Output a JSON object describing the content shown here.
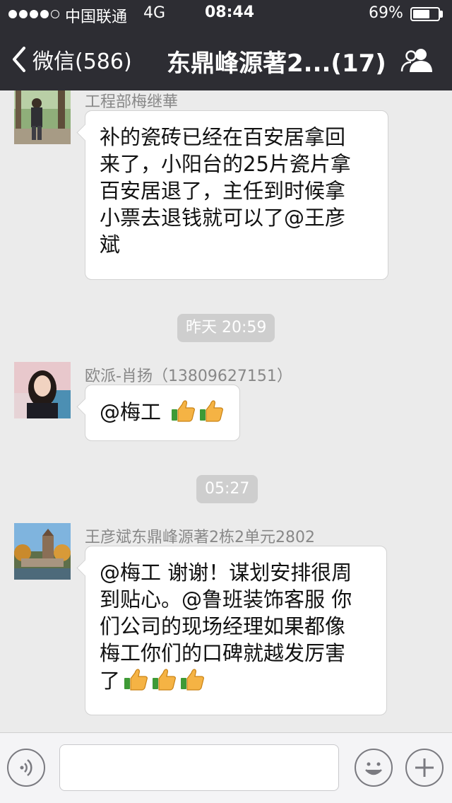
{
  "status_bar": {
    "carrier": "中国联通",
    "network": "4G",
    "time": "08:44",
    "battery_percent": "69%",
    "battery_level": 0.69,
    "signal_bars_filled": 4,
    "signal_bars_total": 5
  },
  "nav": {
    "back_label": "微信(586)",
    "title": "东鼎峰源著2...(17)",
    "back_icon": "chevron-left-icon",
    "members_icon": "group-members-icon"
  },
  "messages": [
    {
      "sender": "工程部梅继華",
      "text": "补的瓷砖已经在百安居拿回\n来了，小阳台的25片瓷片拿\n百安居退了，主任到时候拿\n小票去退钱就可以了@王彦\n斌"
    },
    {
      "timestamp": "昨天 20:59"
    },
    {
      "sender": "欧派-肖扬（13809627151）",
      "text": "@梅工 ",
      "emoji_count": 2
    },
    {
      "timestamp": "05:27"
    },
    {
      "sender": "王彦斌东鼎峰源著2栋2单元2802",
      "text": "@梅工 谢谢！谋划安排很周\n到贴心。@鲁班装饰客服 你\n们公司的现场经理如果都像\n梅工你们的口碑就越发厉害\n了",
      "emoji_count": 3
    }
  ],
  "input_bar": {
    "voice_icon": "voice-icon",
    "emoji_icon": "smiley-icon",
    "plus_icon": "plus-icon",
    "input_value": ""
  },
  "colors": {
    "header_bg": "#2d2d33",
    "chat_bg": "#ebebeb",
    "bubble_bg": "#ffffff",
    "timestamp_bg": "#cecece"
  }
}
